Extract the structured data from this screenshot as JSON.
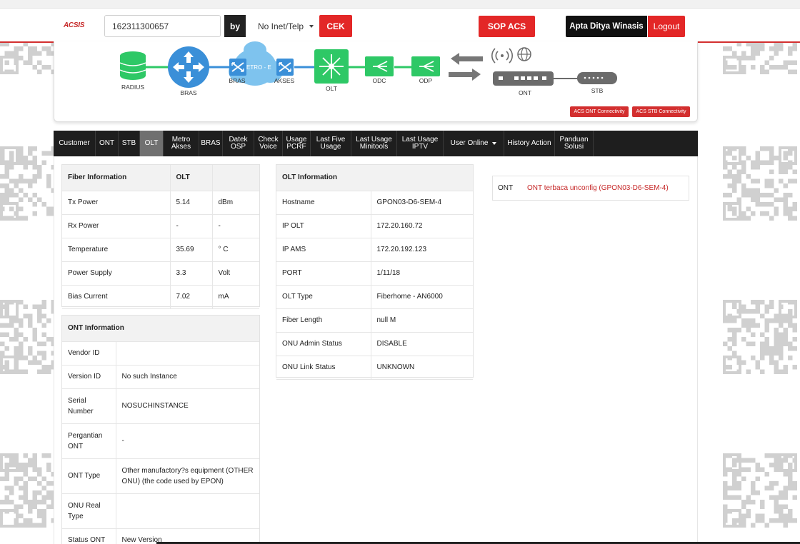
{
  "header": {
    "logo_text": "ACSIS",
    "search_value": "162311300657",
    "by_label": "by",
    "by_select_value": "No Inet/Telp",
    "cek_label": "CEK",
    "sop_label": "SOP ACS",
    "user_name": "Apta Ditya Winasis",
    "logout_label": "Logout"
  },
  "topology": {
    "labels": [
      "RADIUS",
      "BRAS",
      "BRAS",
      "AKSES",
      "OLT",
      "ODC",
      "ODP",
      "ONT",
      "STB"
    ],
    "metro_label": "METRO - E",
    "ont_connectivity_label": "ACS ONT Connectivity",
    "stb_connectivity_label": "ACS STB Connectivity",
    "colors": {
      "green": "#2ec866",
      "blue": "#3a8fd8",
      "cloud": "#7ec3ee",
      "device": "#6b6b6b",
      "arrow": "#777777"
    }
  },
  "tabs": [
    {
      "label": "Customer",
      "active": false
    },
    {
      "label": "ONT",
      "active": false
    },
    {
      "label": "STB",
      "active": false
    },
    {
      "label": "OLT",
      "active": true
    },
    {
      "label": "Metro Akses",
      "active": false
    },
    {
      "label": "BRAS",
      "active": false
    },
    {
      "label": "Datek OSP",
      "active": false
    },
    {
      "label": "Check Voice",
      "active": false
    },
    {
      "label": "Usage PCRF",
      "active": false
    },
    {
      "label": "Last Five Usage",
      "active": false
    },
    {
      "label": "Last Usage Minitools",
      "active": false
    },
    {
      "label": "Last Usage IPTV",
      "active": false
    },
    {
      "label": "User Online",
      "active": false,
      "dropdown": true
    },
    {
      "label": "History Action",
      "active": false
    },
    {
      "label": "Panduan Solusi",
      "active": false
    }
  ],
  "fiber_info": {
    "header": [
      "Fiber Information",
      "OLT",
      ""
    ],
    "rows": [
      [
        "Tx Power",
        "5.14",
        "dBm"
      ],
      [
        "Rx Power",
        "-",
        "-"
      ],
      [
        "Temperature",
        "35.69",
        "° C"
      ],
      [
        "Power Supply",
        "3.3",
        "Volt"
      ],
      [
        "Bias Current",
        "7.02",
        "mA"
      ]
    ]
  },
  "olt_info": {
    "header": "OLT Information",
    "rows": [
      [
        "Hostname",
        "GPON03-D6-SEM-4"
      ],
      [
        "IP OLT",
        "172.20.160.72"
      ],
      [
        "IP AMS",
        "172.20.192.123"
      ],
      [
        "PORT",
        "1/11/18"
      ],
      [
        "OLT Type",
        "Fiberhome - AN6000"
      ],
      [
        "Fiber Length",
        "null M"
      ],
      [
        "ONU Admin Status",
        "DISABLE"
      ],
      [
        "ONU Link Status",
        "UNKNOWN"
      ]
    ]
  },
  "ont_info": {
    "header": "ONT Information",
    "rows": [
      [
        "Vendor ID",
        ""
      ],
      [
        "Version ID",
        "No such Instance"
      ],
      [
        "Serial Number",
        "NOSUCHINSTANCE"
      ],
      [
        "Pergantian ONT",
        "-"
      ],
      [
        "ONT Type",
        "Other manufactory?s equipment (OTHER ONU) (the code used by EPON)"
      ],
      [
        "ONU Real Type",
        ""
      ],
      [
        "Status ONT",
        "New Version"
      ]
    ]
  },
  "ont_status": {
    "label": "ONT",
    "value": "ONT terbaca unconfig (GPON03-D6-SEM-4)"
  }
}
